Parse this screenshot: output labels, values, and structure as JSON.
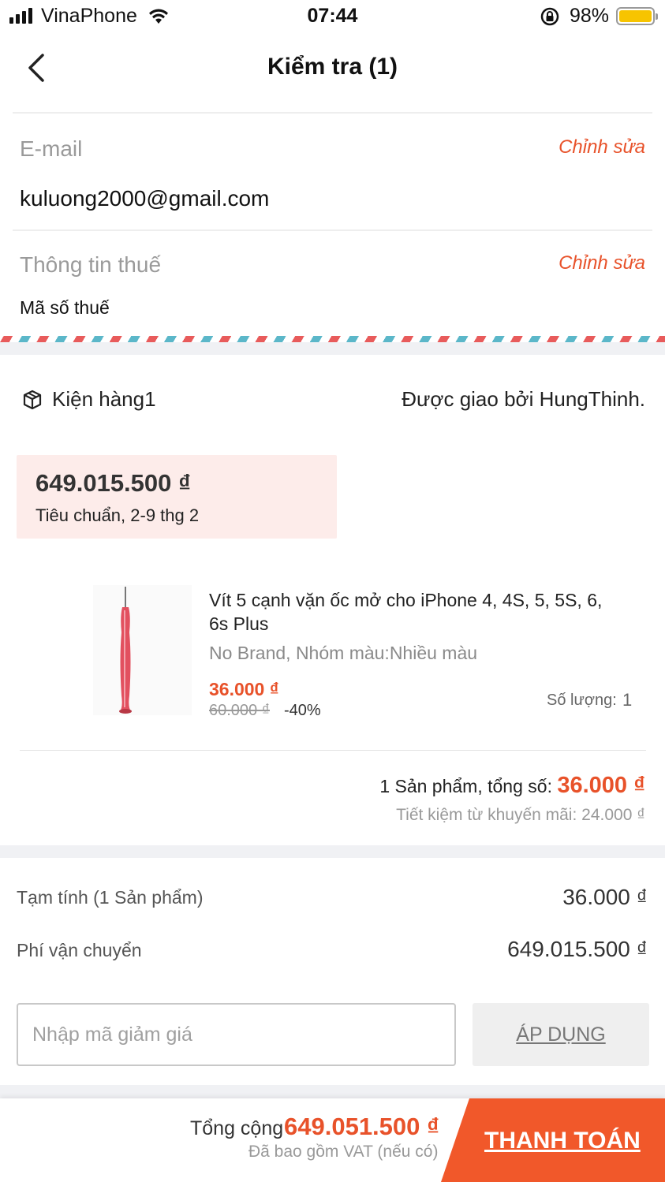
{
  "status_bar": {
    "carrier": "VinaPhone",
    "time": "07:44",
    "battery_percent": "98%",
    "battery_level": 0.98,
    "battery_color": "#f7c400"
  },
  "nav": {
    "title": "Kiểm tra (1)",
    "back_icon": "chevron-left-icon"
  },
  "email_section": {
    "label": "E-mail",
    "edit_label": "Chỉnh sửa",
    "value": "kuluong2000@gmail.com"
  },
  "tax_section": {
    "label": "Thông tin thuế",
    "edit_label": "Chỉnh sửa",
    "value": "Mã số thuế"
  },
  "package": {
    "icon": "package-icon",
    "title": "Kiện hàng1",
    "delivered_by": "Được giao bởi HungThinh.",
    "shipping_price": "649.015.500 ₫",
    "shipping_method": "Tiêu chuẩn, 2-9 thg 2"
  },
  "product": {
    "name": "Vít 5 cạnh vặn ốc mở cho  iPhone 4, 4S, 5, 5S, 6, 6s Plus",
    "variant": "No Brand, Nhóm màu:Nhiều màu",
    "price": "36.000 ₫",
    "original_price": "60.000 ₫",
    "discount": "-40%",
    "quantity_label": "Số lượng:",
    "quantity": "1"
  },
  "package_summary": {
    "count_text": "1 Sản phẩm, tổng số:",
    "total": "36.000 ₫",
    "savings": "Tiết kiệm từ khuyến mãi: 24.000 ₫"
  },
  "order_summary": {
    "subtotal_label": "Tạm tính  (1 Sản phẩm)",
    "subtotal_value": "36.000 ₫",
    "shipping_label": "Phí vận chuyển",
    "shipping_value": "649.015.500 ₫"
  },
  "voucher": {
    "placeholder": "Nhập mã giảm giá",
    "apply_label": "ÁP DỤNG"
  },
  "footer": {
    "total_label": "Tổng cộng",
    "total_value": "649.051.500 ₫",
    "vat_note": "Đã bao gồm VAT (nếu có)",
    "checkout_label": "THANH TOÁN"
  },
  "colors": {
    "accent": "#e8522a",
    "checkout_bg": "#f1582a",
    "shipping_box_bg": "#fdecea"
  }
}
